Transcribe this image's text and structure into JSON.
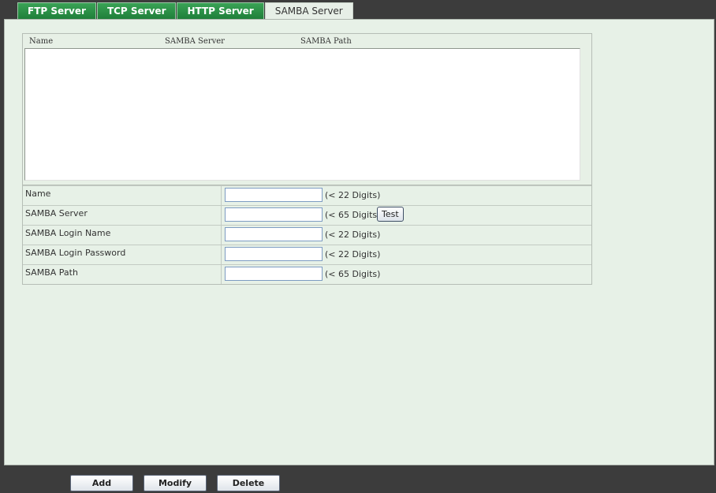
{
  "tabs": [
    {
      "label": "FTP Server"
    },
    {
      "label": "TCP Server"
    },
    {
      "label": "HTTP Server"
    },
    {
      "label": "SAMBA Server"
    }
  ],
  "list": {
    "columns": [
      "Name",
      "SAMBA Server",
      "SAMBA Path"
    ],
    "rows": []
  },
  "form": {
    "fields": [
      {
        "label": "Name",
        "value": "",
        "hint": "(< 22 Digits)"
      },
      {
        "label": "SAMBA Server",
        "value": "",
        "hint": "(< 65 Digits)",
        "button": "Test"
      },
      {
        "label": "SAMBA Login Name",
        "value": "",
        "hint": "(< 22 Digits)"
      },
      {
        "label": "SAMBA Login Password",
        "value": "",
        "hint": "(< 22 Digits)"
      },
      {
        "label": "SAMBA Path",
        "value": "",
        "hint": "(< 65 Digits)"
      }
    ]
  },
  "buttons": {
    "add": "Add",
    "modify": "Modify",
    "delete": "Delete"
  }
}
